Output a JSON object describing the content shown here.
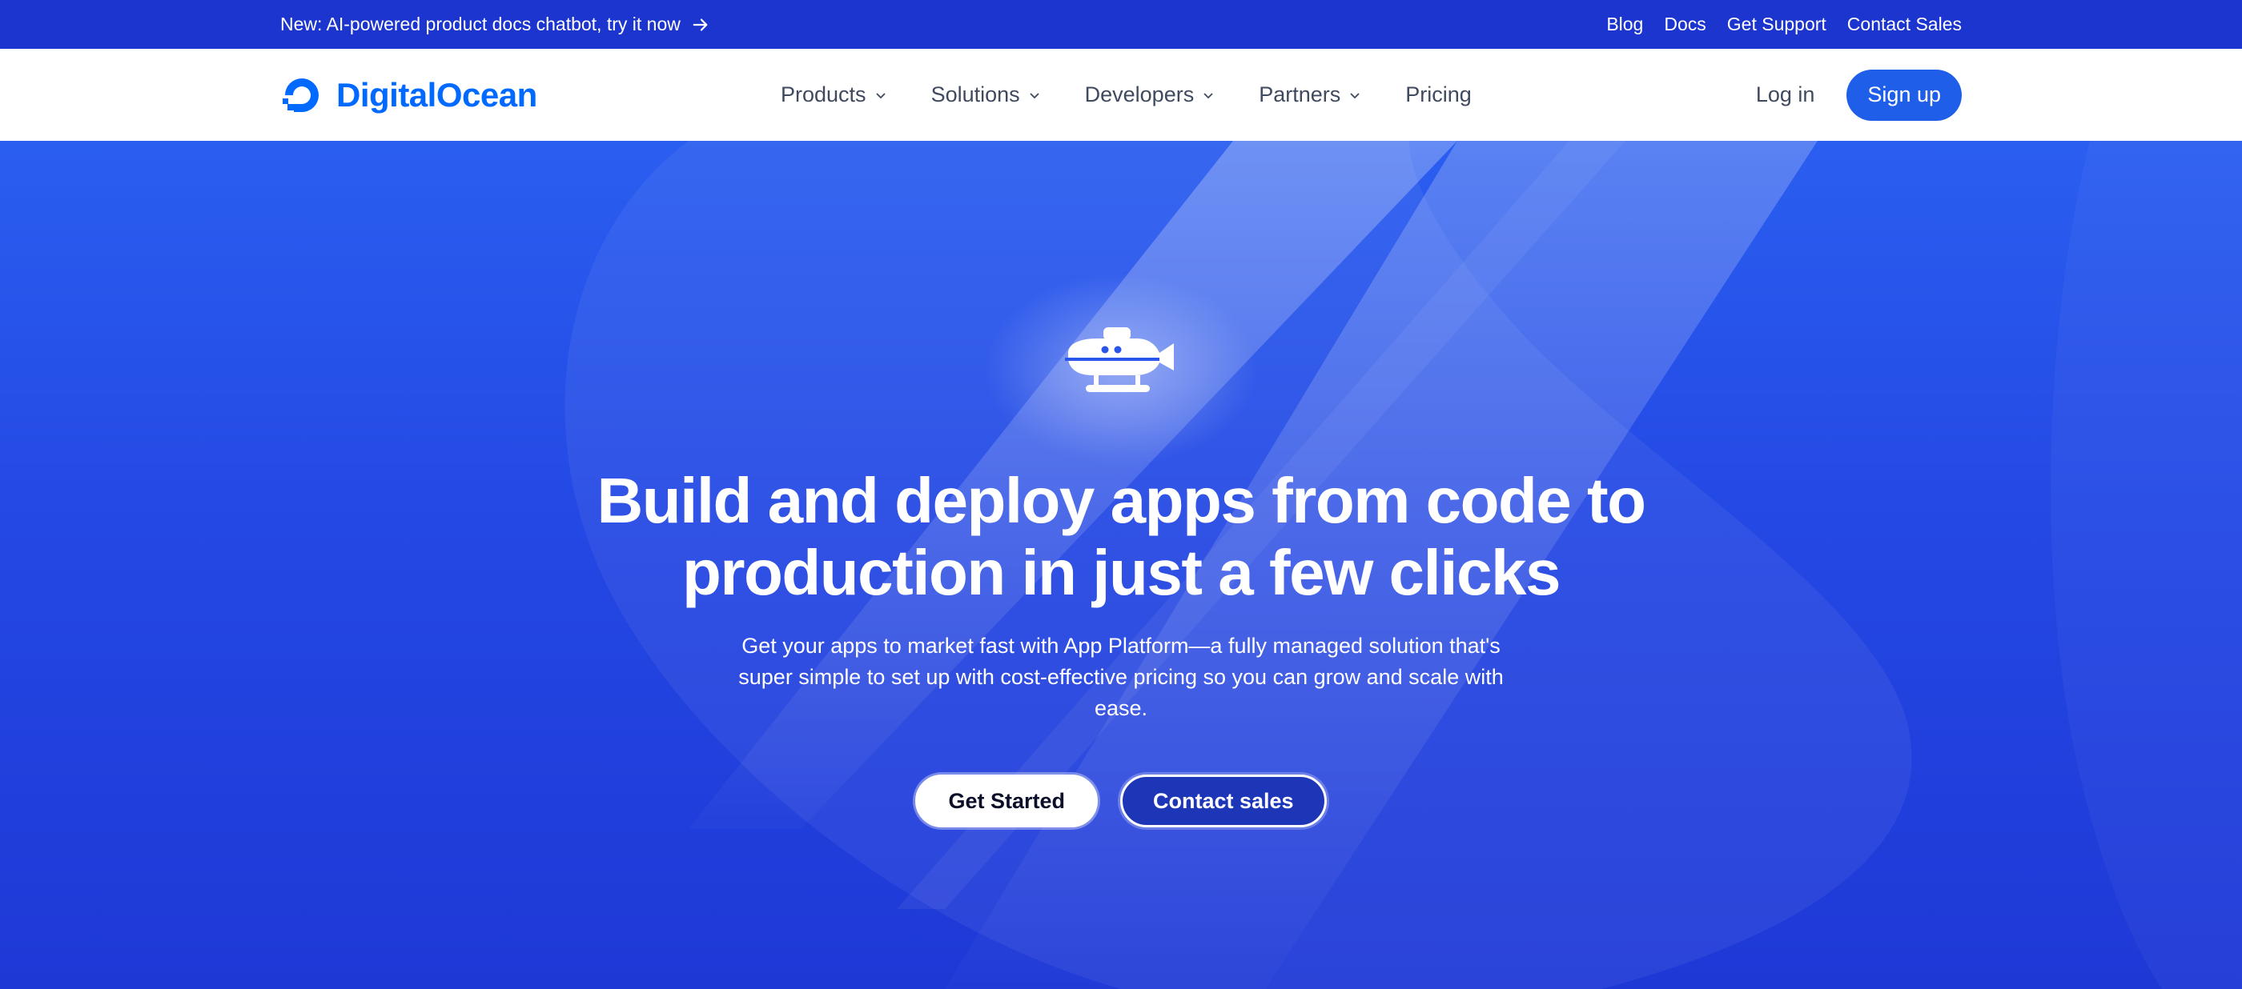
{
  "announcement": {
    "text": "New: AI-powered product docs chatbot, try it now",
    "links": [
      "Blog",
      "Docs",
      "Get Support",
      "Contact Sales"
    ]
  },
  "brand": {
    "name": "DigitalOcean",
    "color": "#0069ff"
  },
  "nav": {
    "items": [
      {
        "label": "Products",
        "dropdown": true
      },
      {
        "label": "Solutions",
        "dropdown": true
      },
      {
        "label": "Developers",
        "dropdown": true
      },
      {
        "label": "Partners",
        "dropdown": true
      },
      {
        "label": "Pricing",
        "dropdown": false
      }
    ],
    "login_label": "Log in",
    "signup_label": "Sign up"
  },
  "hero": {
    "icon": "submarine-icon",
    "title_line1": "Build and deploy apps from code to",
    "title_line2": "production in just a few clicks",
    "description": "Get your apps to market fast with App Platform—a fully managed solution that's super simple to set up with cost-effective pricing so you can grow and scale with ease.",
    "primary_button": "Get Started",
    "secondary_button": "Contact sales"
  },
  "colors": {
    "announcement_bg": "#1c35cf",
    "hero_bg": "#2448e4",
    "signup_bg": "#1f5ee8"
  }
}
